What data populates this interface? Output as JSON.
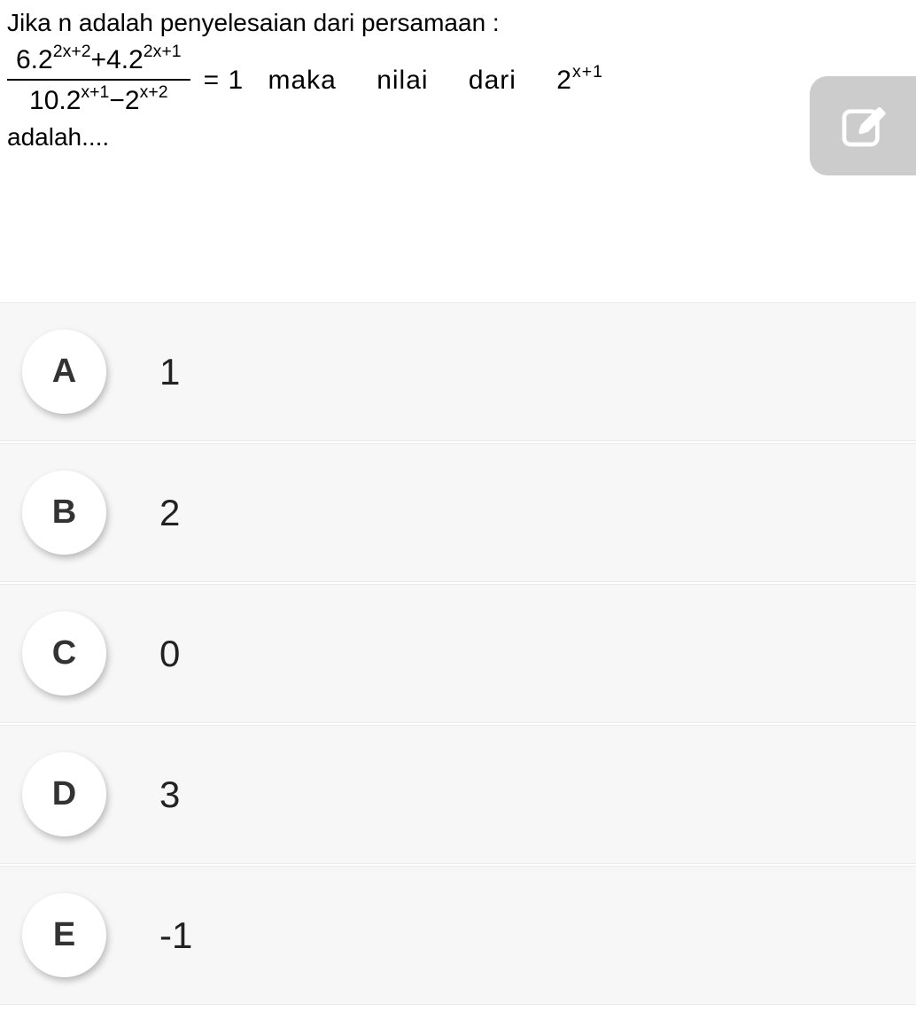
{
  "question": {
    "intro": "Jika n adalah penyelesaian dari persamaan :",
    "numerator_a": "6.2",
    "numerator_exp_a": "2x+2",
    "numerator_plus": "+4.2",
    "numerator_exp_b": "2x+1",
    "denominator_a": "10.2",
    "denominator_exp_a": "x+1",
    "denominator_minus": "−2",
    "denominator_exp_b": "x+2",
    "equals": "= 1",
    "word_maka": "maka",
    "word_nilai": "nilai",
    "word_dari": "dari",
    "rhs_base": "2",
    "rhs_exp": "x+1",
    "tail": "adalah...."
  },
  "answers": [
    {
      "label": "A",
      "text": "1"
    },
    {
      "label": "B",
      "text": "2"
    },
    {
      "label": "C",
      "text": "0"
    },
    {
      "label": "D",
      "text": "3"
    },
    {
      "label": "E",
      "text": "-1"
    }
  ]
}
